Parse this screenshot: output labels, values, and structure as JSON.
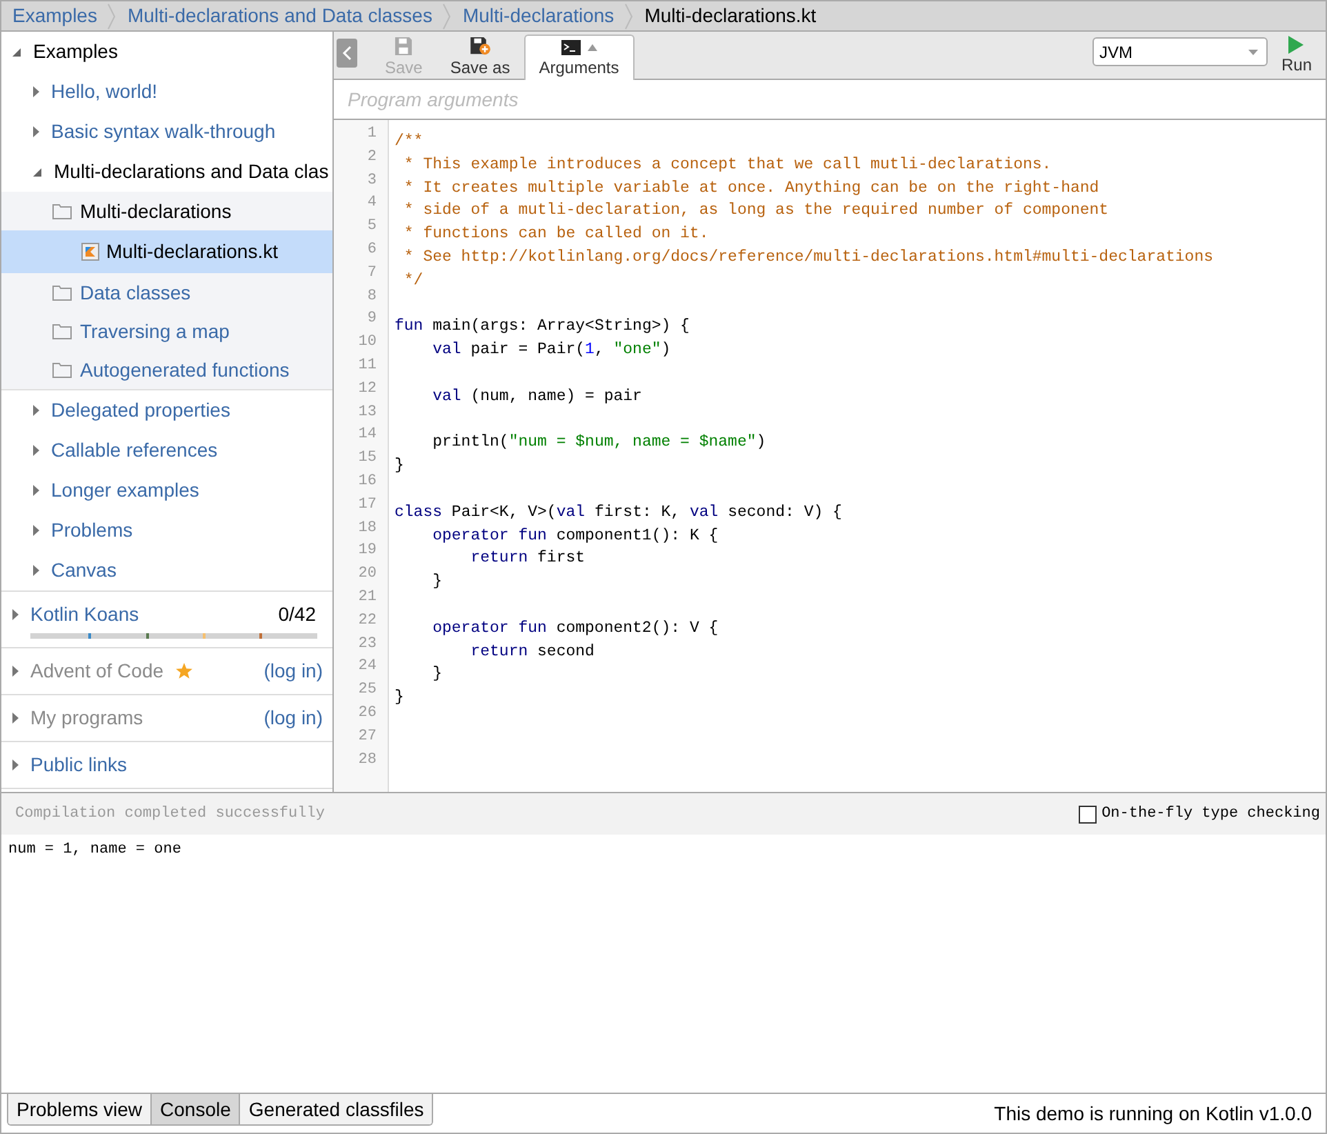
{
  "breadcrumb": [
    "Examples",
    "Multi-declarations and Data classes",
    "Multi-declarations",
    "Multi-declarations.kt"
  ],
  "tree": [
    {
      "label": "Examples",
      "kind": "root",
      "expanded": true,
      "children": [
        {
          "label": "Hello, world!",
          "kind": "group",
          "expanded": false
        },
        {
          "label": "Basic syntax walk-through",
          "kind": "group",
          "expanded": false
        },
        {
          "label": "Multi-declarations and Data clas",
          "kind": "group",
          "expanded": true,
          "children": [
            {
              "label": "Multi-declarations",
              "kind": "folder",
              "children": [
                {
                  "label": "Multi-declarations.kt",
                  "kind": "file",
                  "selected": true
                }
              ]
            },
            {
              "label": "Data classes",
              "kind": "folder"
            },
            {
              "label": "Traversing a map",
              "kind": "folder"
            },
            {
              "label": "Autogenerated functions",
              "kind": "folder"
            }
          ]
        },
        {
          "label": "Delegated properties",
          "kind": "group",
          "expanded": false
        },
        {
          "label": "Callable references",
          "kind": "group",
          "expanded": false
        },
        {
          "label": "Longer examples",
          "kind": "group",
          "expanded": false
        },
        {
          "label": "Problems",
          "kind": "group",
          "expanded": false
        },
        {
          "label": "Canvas",
          "kind": "group",
          "expanded": false
        }
      ]
    }
  ],
  "sections": [
    {
      "label": "Kotlin Koans",
      "kind": "progress",
      "count": "0/42",
      "level": 0,
      "disabled": false
    },
    {
      "label": "Advent of Code",
      "kind": "login",
      "link": "(log in)",
      "starred": true,
      "disabled": true
    },
    {
      "label": "My programs",
      "kind": "login",
      "link": "(log in)",
      "starred": false,
      "disabled": true
    },
    {
      "label": "Public links",
      "kind": "plain",
      "disabled": false
    }
  ],
  "toolbar": {
    "buttons": [
      {
        "label": "Save",
        "kind": "save",
        "disabled": true,
        "selected": false
      },
      {
        "label": "Save as",
        "kind": "save-as",
        "disabled": false,
        "selected": false
      },
      {
        "label": "Arguments",
        "kind": "arguments",
        "disabled": false,
        "selected": true
      }
    ],
    "target": "JVM",
    "run": "Run"
  },
  "arguments": {
    "placeholder": "Program arguments"
  },
  "code": [
    {
      "tokens": [
        {
          "kind": "comment",
          "text": "/**"
        }
      ]
    },
    {
      "tokens": [
        {
          "kind": "comment",
          "text": " * This example introduces a concept that we call mutli-declarations."
        }
      ]
    },
    {
      "tokens": [
        {
          "kind": "comment",
          "text": " * It creates multiple variable at once. Anything can be on the right-hand"
        }
      ]
    },
    {
      "tokens": [
        {
          "kind": "comment",
          "text": " * side of a mutli-declaration, as long as the required number of component"
        }
      ]
    },
    {
      "tokens": [
        {
          "kind": "comment",
          "text": " * functions can be called on it."
        }
      ]
    },
    {
      "tokens": [
        {
          "kind": "comment",
          "text": " * See http://kotlinlang.org/docs/reference/multi-declarations.html#multi-declarations"
        }
      ]
    },
    {
      "tokens": [
        {
          "kind": "comment",
          "text": " */"
        }
      ]
    },
    {
      "kind": "blank"
    },
    {
      "tokens": [
        {
          "kind": "keyword",
          "text": "fun"
        },
        {
          "kind": "plain",
          "text": " main(args: Array<String>) {"
        }
      ]
    },
    {
      "tokens": [
        {
          "kind": "keyword",
          "text": "    val"
        },
        {
          "kind": "plain",
          "text": " pair = Pair("
        },
        {
          "kind": "number",
          "text": "1"
        },
        {
          "kind": "plain",
          "text": ", "
        },
        {
          "kind": "string",
          "text": "\"one\""
        },
        {
          "kind": "plain",
          "text": ")"
        }
      ]
    },
    {
      "kind": "blank"
    },
    {
      "tokens": [
        {
          "kind": "keyword",
          "text": "    val"
        },
        {
          "kind": "plain",
          "text": " (num, name) = pair"
        }
      ]
    },
    {
      "kind": "blank"
    },
    {
      "tokens": [
        {
          "kind": "plain",
          "text": "    println("
        },
        {
          "kind": "string",
          "text": "\"num = $num, name = $name\""
        },
        {
          "kind": "plain",
          "text": ")"
        }
      ]
    },
    {
      "tokens": [
        {
          "kind": "plain",
          "text": "}"
        }
      ]
    },
    {
      "kind": "blank"
    },
    {
      "tokens": [
        {
          "kind": "keyword",
          "text": "class"
        },
        {
          "kind": "plain",
          "text": " Pair<K, V>("
        },
        {
          "kind": "keyword",
          "text": "val"
        },
        {
          "kind": "plain",
          "text": " first: K, "
        },
        {
          "kind": "keyword",
          "text": "val"
        },
        {
          "kind": "plain",
          "text": " second: V) {"
        }
      ]
    },
    {
      "tokens": [
        {
          "kind": "keyword",
          "text": "    operator fun"
        },
        {
          "kind": "plain",
          "text": " component1(): K {"
        }
      ]
    },
    {
      "tokens": [
        {
          "kind": "keyword",
          "text": "        return"
        },
        {
          "kind": "plain",
          "text": " first"
        }
      ]
    },
    {
      "tokens": [
        {
          "kind": "plain",
          "text": "    }"
        }
      ]
    },
    {
      "kind": "blank"
    },
    {
      "tokens": [
        {
          "kind": "keyword",
          "text": "    operator fun"
        },
        {
          "kind": "plain",
          "text": " component2(): V {"
        }
      ]
    },
    {
      "tokens": [
        {
          "kind": "keyword",
          "text": "        return"
        },
        {
          "kind": "plain",
          "text": " second"
        }
      ]
    },
    {
      "tokens": [
        {
          "kind": "plain",
          "text": "    }"
        }
      ]
    },
    {
      "tokens": [
        {
          "kind": "plain",
          "text": "}"
        }
      ]
    },
    {
      "kind": "blank"
    },
    {
      "kind": "blank"
    },
    {
      "kind": "blank"
    }
  ],
  "line_numbers": [
    "1",
    "2",
    "3",
    "4",
    "5",
    "6",
    "7",
    "8",
    "9",
    "10",
    "11",
    "12",
    "13",
    "14",
    "15",
    "16",
    "17",
    "18",
    "19",
    "20",
    "21",
    "22",
    "23",
    "24",
    "25",
    "26",
    "27",
    "28"
  ],
  "console": {
    "status": "Compilation completed successfully",
    "type_checking": {
      "label": "On-the-fly type checking",
      "checked": false
    },
    "output": "num = 1, name = one"
  },
  "bottom_tabs": [
    {
      "label": "Problems view",
      "selected": false
    },
    {
      "label": "Console",
      "selected": true
    },
    {
      "label": "Generated classfiles",
      "selected": false
    }
  ],
  "footer": "This demo is running on Kotlin v1.0.0"
}
